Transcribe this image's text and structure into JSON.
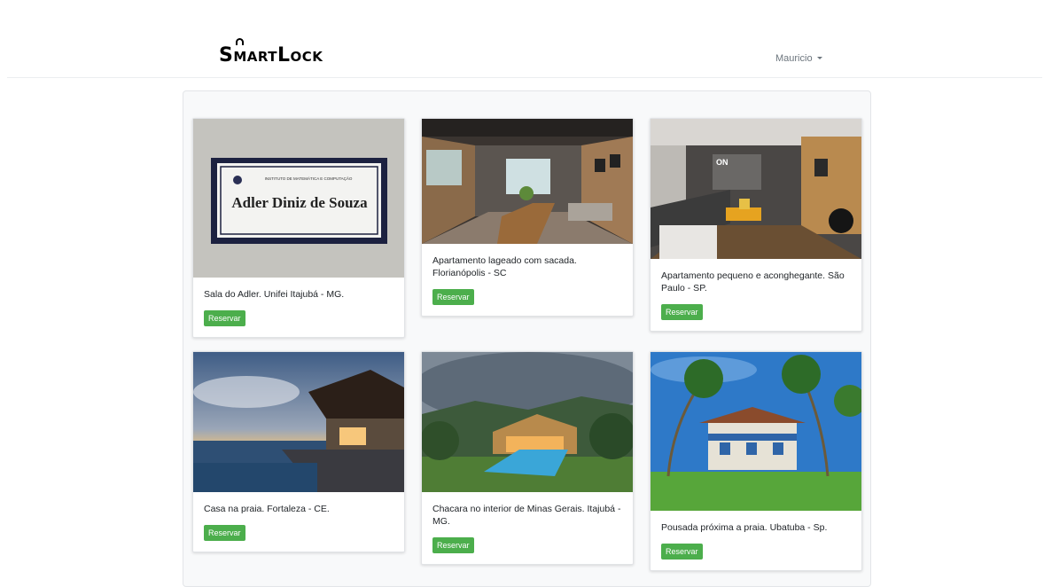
{
  "navbar": {
    "brand": "SmartLock",
    "user": "Mauricio"
  },
  "listings": [
    {
      "description": "Sala do Adler. Unifei Itajubá - MG.",
      "button": "Reservar",
      "sign_header": "INSTITUTO DE MATEMÁTICA E COMPUTAÇÃO",
      "sign_name": "Adler Diniz de Souza"
    },
    {
      "description": "Apartamento lageado com sacada. Florianópolis - SC",
      "button": "Reservar"
    },
    {
      "description": "Apartamento pequeno e aconghegante. São Paulo - SP.",
      "button": "Reservar",
      "sign_text": "ON"
    },
    {
      "description": "Casa na praia. Fortaleza - CE.",
      "button": "Reservar"
    },
    {
      "description": "Chacara no interior de Minas Gerais. Itajubá - MG.",
      "button": "Reservar"
    },
    {
      "description": "Pousada próxima a praia. Ubatuba - Sp.",
      "button": "Reservar"
    }
  ],
  "colors": {
    "button": "#4cae4c",
    "panel": "#f8f9fa"
  }
}
